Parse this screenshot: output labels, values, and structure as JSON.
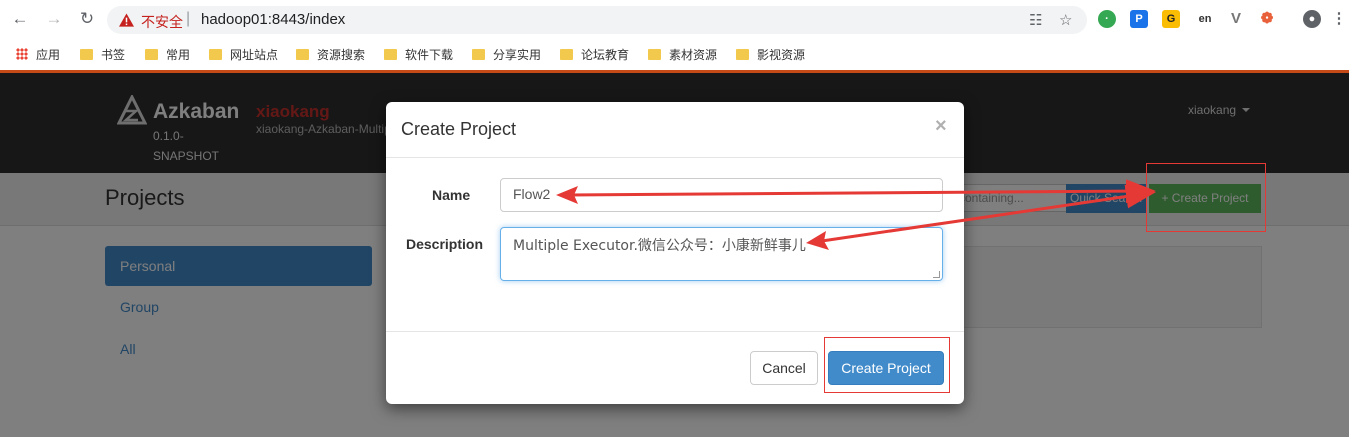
{
  "browser": {
    "insecure_label": "不安全",
    "url": "hadoop01:8443/index",
    "bookmarks": [
      "应用",
      "书签",
      "常用",
      "网址站点",
      "资源搜索",
      "软件下载",
      "分享实用",
      "论坛教育",
      "素材资源",
      "影视资源"
    ]
  },
  "header": {
    "brand": "Azkaban",
    "version": "0.1.0-SNAPSHOT",
    "project_name": "xiaokang",
    "project_desc": "xiaokang-Azkaban-Multiple",
    "user": "xiaokang"
  },
  "page": {
    "title": "Projects",
    "search_placeholder": "containing...",
    "quick_search_label": "Quick Search",
    "create_project_label": "+ Create Project"
  },
  "nav": {
    "items": [
      "Personal",
      "Group",
      "All"
    ]
  },
  "modal": {
    "title": "Create Project",
    "close_glyph": "×",
    "name_label": "Name",
    "name_value": "Flow2",
    "description_label": "Description",
    "description_value": "Multiple Executor.微信公众号：小康新鲜事儿",
    "cancel_label": "Cancel",
    "create_label": "Create Project"
  },
  "colors": {
    "primary": "#428bca",
    "success": "#5cb85c",
    "header_bg": "#2f2f2f",
    "annotation": "#e53935"
  }
}
